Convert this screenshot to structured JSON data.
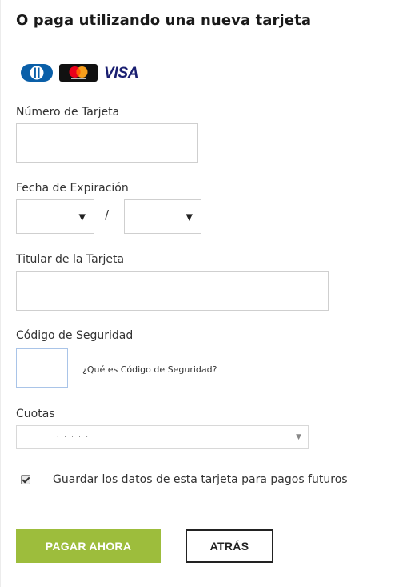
{
  "header": {
    "title": "O paga utilizando una nueva tarjeta"
  },
  "card_brands": {
    "diners": "diners-club-icon",
    "mastercard": "mastercard-icon",
    "visa_label": "VISA",
    "visa_color": "#1a1f71"
  },
  "form": {
    "card_number": {
      "label": "Número de Tarjeta",
      "value": ""
    },
    "expiration": {
      "label": "Fecha de Expiración",
      "month_value": "",
      "year_value": "",
      "separator": "/"
    },
    "holder": {
      "label": "Titular de la Tarjeta",
      "value": ""
    },
    "security_code": {
      "label": "Código de Seguridad",
      "value": "",
      "help_link": "¿Qué es Código de Seguridad?"
    },
    "installments": {
      "label": "Cuotas",
      "selected_value": "· ·   · ·  ·"
    },
    "save_card": {
      "label": "Guardar los datos de esta tarjeta para pagos futuros",
      "checked": true
    }
  },
  "actions": {
    "pay_label": "PAGAR AHORA",
    "back_label": "ATRÁS",
    "pay_color": "#9dbd3c"
  }
}
